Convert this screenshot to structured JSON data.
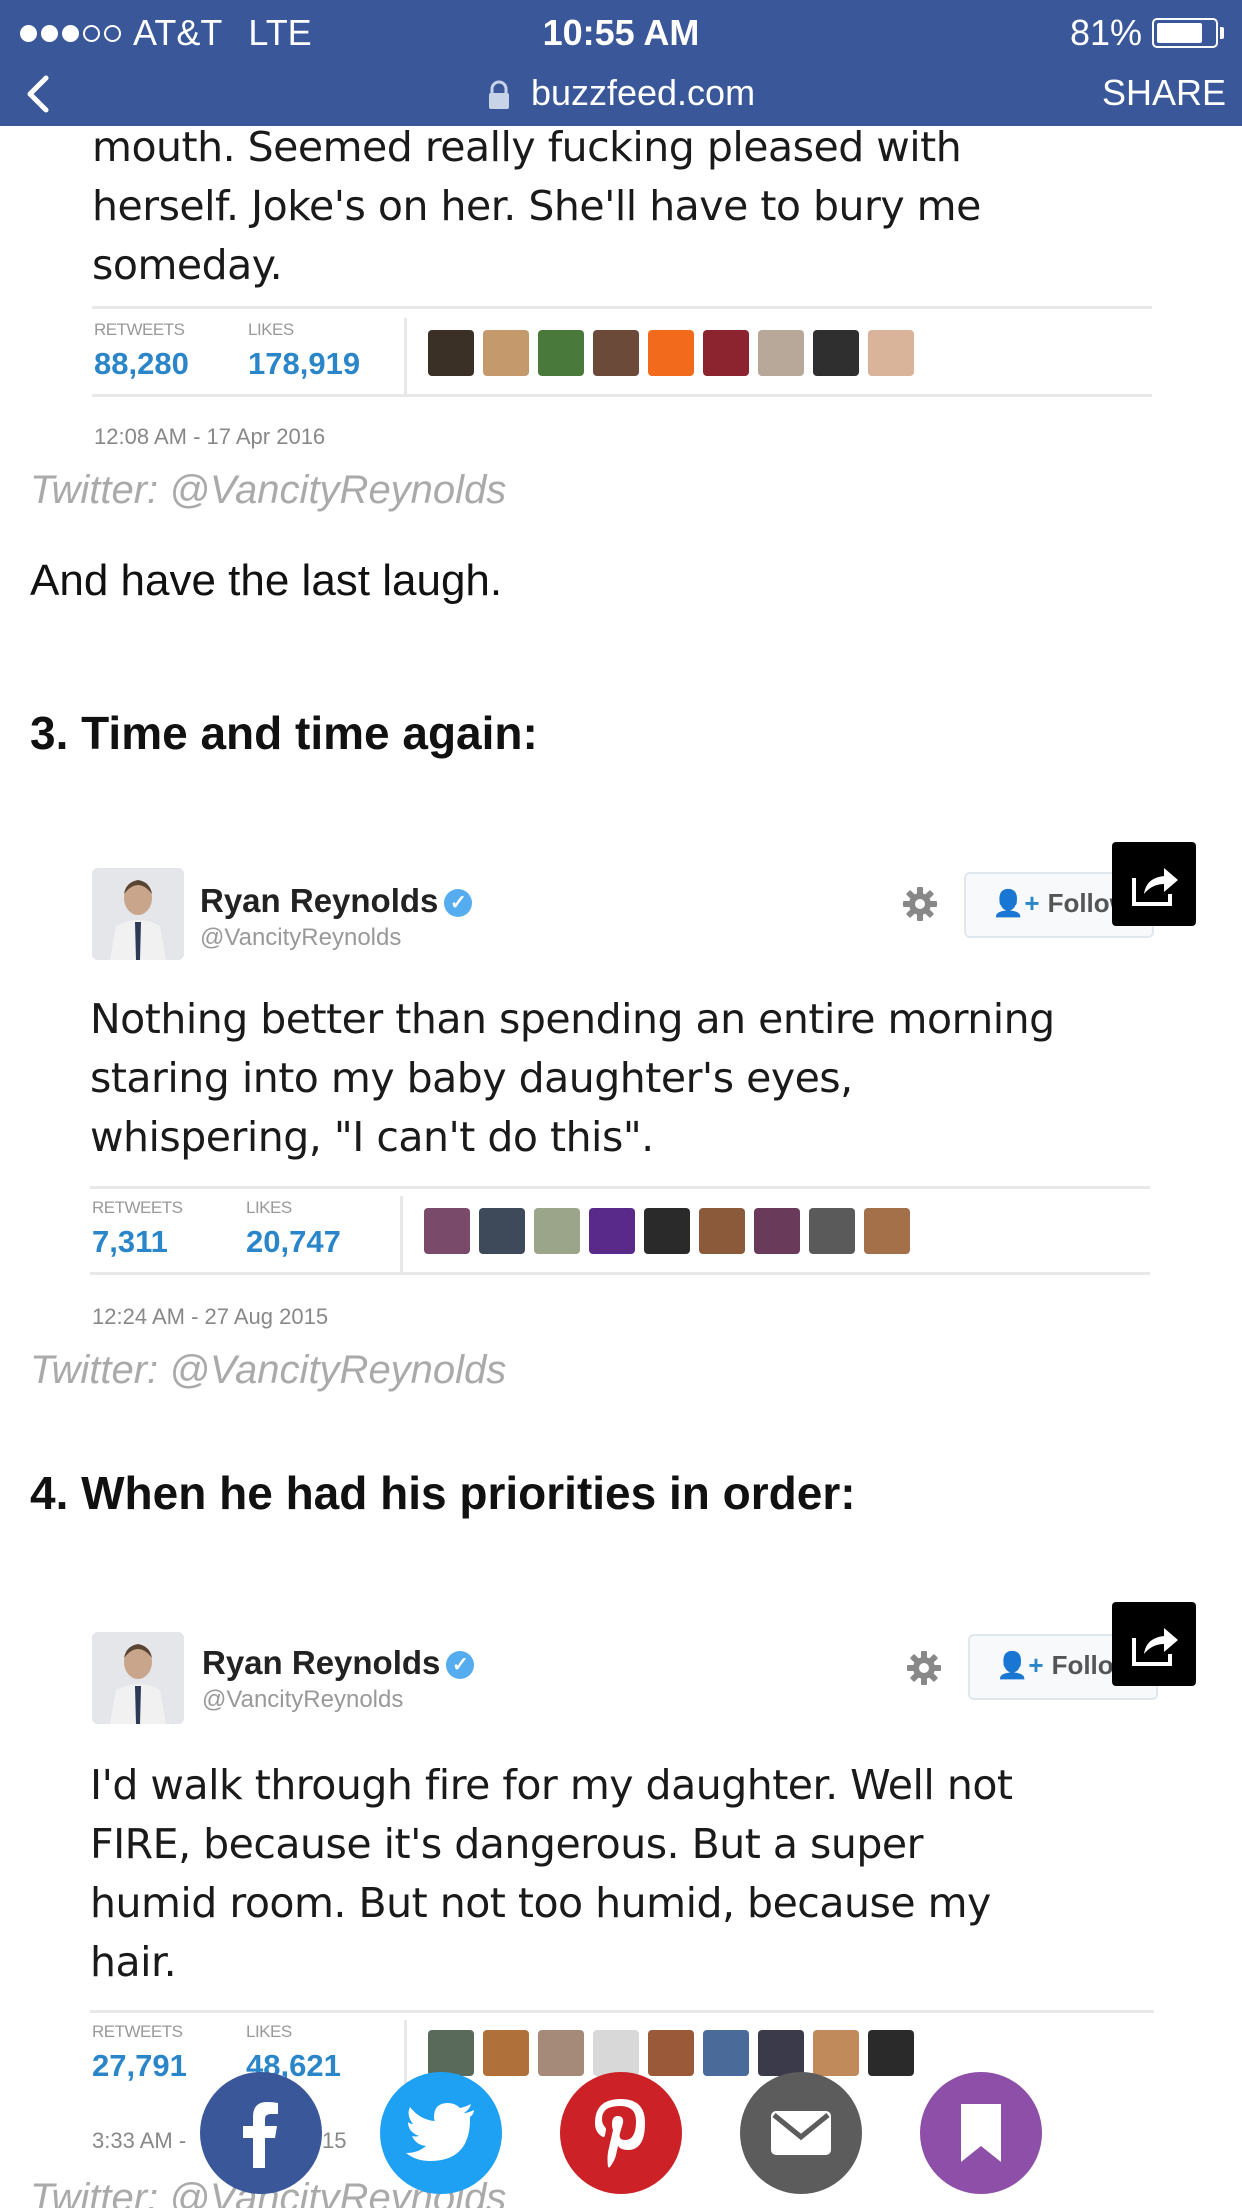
{
  "status_bar": {
    "carrier": "AT&T",
    "network": "LTE",
    "time": "10:55 AM",
    "battery": "81%",
    "battery_level": 0.81
  },
  "nav": {
    "url": "buzzfeed.com",
    "share_label": "SHARE"
  },
  "tweet1": {
    "text_lines": [
      "mouth. Seemed really fucking pleased with",
      "herself. Joke's on her. She'll have to bury me",
      "someday."
    ],
    "retweets_label": "RETWEETS",
    "retweets": "88,280",
    "likes_label": "LIKES",
    "likes": "178,919",
    "date": "12:08 AM - 17 Apr 2016"
  },
  "credit1": "Twitter: @VancityReynolds",
  "paragraph1": "And have the last laugh.",
  "heading3": "3. Time and time again:",
  "tweet2": {
    "name": "Ryan Reynolds",
    "handle": "@VancityReynolds",
    "follow_label": "Follow",
    "text_lines": [
      "Nothing better than spending an entire morning",
      "staring into my baby daughter's eyes,",
      "whispering, \"I can't do this\"."
    ],
    "retweets_label": "RETWEETS",
    "retweets": "7,311",
    "likes_label": "LIKES",
    "likes": "20,747",
    "date": "12:24 AM - 27 Aug 2015"
  },
  "credit2": "Twitter: @VancityReynolds",
  "heading4": "4. When he had his priorities in order:",
  "tweet3": {
    "name": "Ryan Reynolds",
    "handle": "@VancityReynolds",
    "follow_label": "Follow",
    "text_lines": [
      "I'd walk through fire for my daughter. Well not",
      "FIRE, because it's dangerous. But a super",
      "humid room. But not too humid, because my",
      "hair."
    ],
    "retweets_label": "RETWEETS",
    "retweets": "27,791",
    "likes_label": "LIKES",
    "likes": "48,621",
    "date_partial": "3:33 AM -",
    "date_tail": "15"
  },
  "credit3": "Twitter: @VancityReynolds",
  "share_buttons": [
    {
      "name": "facebook",
      "color": "#3a5899"
    },
    {
      "name": "twitter",
      "color": "#1ea1f2"
    },
    {
      "name": "pinterest",
      "color": "#cb2127"
    },
    {
      "name": "email",
      "color": "#5c5c5c"
    },
    {
      "name": "bookmark",
      "color": "#8d4fa8"
    }
  ],
  "colors": {
    "nav_bg": "#3a5899",
    "stat_blue": "#2a86c8",
    "verified_blue": "#55acee",
    "credit_gray": "#aaaaaa"
  }
}
